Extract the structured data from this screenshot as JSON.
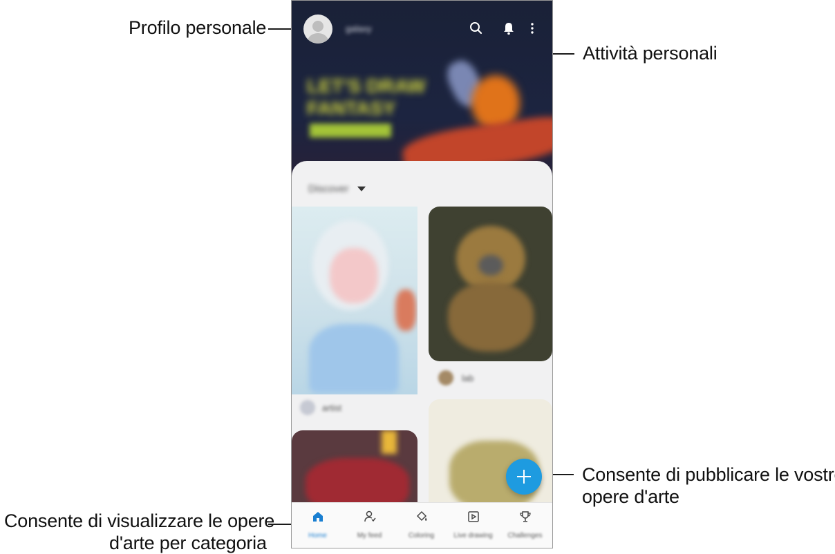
{
  "callouts": {
    "profile": "Profilo personale",
    "activity": "Attività personali",
    "publish_line1": "Consente di pubblicare le vostre",
    "publish_line2": "opere d'arte",
    "category_line1": "Consente di visualizzare le opere",
    "category_line2": "d'arte per categoria"
  },
  "app": {
    "top_bar": {
      "username": "galaxy"
    },
    "banner": {
      "title_line1": "LET'S DRAW",
      "title_line2": "FANTASY"
    },
    "filter": {
      "label": "Discover"
    },
    "cards": [
      {
        "author": "artist"
      },
      {
        "author": "lab"
      }
    ],
    "bottom_nav": [
      "Home",
      "My feed",
      "Coloring",
      "Live drawing",
      "Challenges"
    ]
  },
  "colors": {
    "accent": "#1e9be0",
    "banner_bg": "#1c2440"
  },
  "icons": [
    "search-icon",
    "bell-icon",
    "more-options-icon",
    "plus-icon",
    "home-icon",
    "my-feed-icon",
    "coloring-icon",
    "live-drawing-icon",
    "challenges-icon"
  ]
}
